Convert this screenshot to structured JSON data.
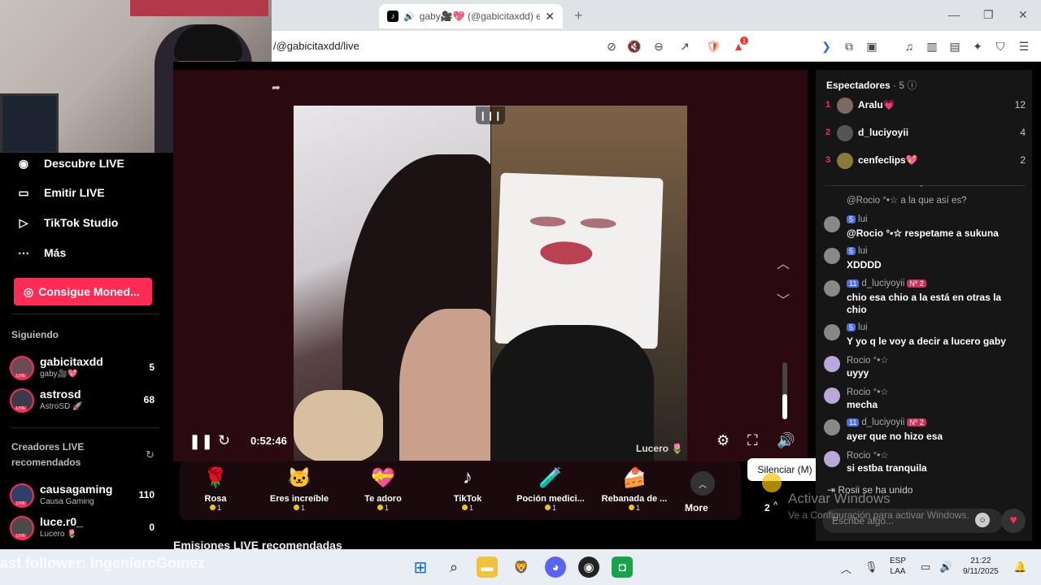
{
  "browser": {
    "tab_title": "gaby🎥💖 (@gabicitaxdd) es",
    "url": "/@gabicitaxdd/live",
    "new_tab": "+",
    "ext_badge": "1"
  },
  "sidebar": {
    "nav": [
      {
        "label": "Descubre LIVE",
        "icon": "live-discover-icon"
      },
      {
        "label": "Emitir LIVE",
        "icon": "camera-icon"
      },
      {
        "label": "TikTok Studio",
        "icon": "studio-icon"
      },
      {
        "label": "Más",
        "icon": "more-dots-icon"
      }
    ],
    "coins_button": "Consigue Moned...",
    "following_title": "Siguiendo",
    "following": [
      {
        "name": "gabicitaxdd",
        "sub": "gaby🎥💖",
        "count": "5",
        "live": "LIVE"
      },
      {
        "name": "astrosd",
        "sub": "AstroSD 🚀",
        "count": "68",
        "live": "LIVE"
      }
    ],
    "creators_title_1": "Creadores LIVE",
    "creators_title_2": "recomendados",
    "creators": [
      {
        "name": "causagaming",
        "sub": "Causa Gaming",
        "count": "110",
        "live": "LIVE"
      },
      {
        "name": "luce.r0_",
        "sub": "Lucero 🌷",
        "count": "0",
        "live": "LIVE"
      }
    ]
  },
  "player": {
    "time": "0:52:46",
    "host_label": "Lucero 🌷",
    "tooltip": "Silenciar (M)",
    "volume": 0.45,
    "side_count": "2"
  },
  "gifts": [
    {
      "name": "Rosa",
      "price": "1",
      "icon": "🌹"
    },
    {
      "name": "Eres increíble",
      "price": "1",
      "icon": "🐱"
    },
    {
      "name": "Te adoro",
      "price": "1",
      "icon": "💝"
    },
    {
      "name": "TikTok",
      "price": "1",
      "icon": "♪"
    },
    {
      "name": "Poción medici...",
      "price": "1",
      "icon": "🧪"
    },
    {
      "name": "Rebanada de ...",
      "price": "1",
      "icon": "🍰"
    }
  ],
  "more_label": "More",
  "recommended_title": "Emisiones LIVE recomendadas",
  "viewers": {
    "title": "Espectadores",
    "count": "· 5",
    "list": [
      {
        "rank": "1",
        "name": "Aralu💗",
        "score": "12"
      },
      {
        "rank": "2",
        "name": "d_luciyoyii",
        "score": "4"
      },
      {
        "rank": "3",
        "name": "cenfeclips💖",
        "score": "2"
      }
    ]
  },
  "chat": [
    {
      "user": "@Rocio °•☆ a la que así es?",
      "text": "",
      "level": "",
      "fan": ""
    },
    {
      "user": "lui",
      "text": "@Rocio °•☆ respetame a sukuna",
      "level": "5",
      "fan": ""
    },
    {
      "user": "lui",
      "text": "XDDDD",
      "level": "5",
      "fan": ""
    },
    {
      "user": "d_luciyoyii",
      "text": "chio esa chio a la está en otras la chio",
      "level": "11",
      "fan": "Nº 2"
    },
    {
      "user": "lui",
      "text": "Y yo q le voy a decir a lucero gaby",
      "level": "5",
      "fan": ""
    },
    {
      "user": "Rocio °•☆",
      "text": "uyyy",
      "level": "",
      "fan": ""
    },
    {
      "user": "Rocio °•☆",
      "text": "mecha",
      "level": "",
      "fan": ""
    },
    {
      "user": "d_luciyoyii",
      "text": "ayer que no hizo esa",
      "level": "11",
      "fan": "Nº 2"
    },
    {
      "user": "Rocio °•☆",
      "text": "si estba tranquila",
      "level": "",
      "fan": ""
    }
  ],
  "joined": "Rosii  se ha unido",
  "comment_placeholder": "Escribe algo...",
  "watermark_title": "Activar Windows",
  "watermark_sub": "Ve a Configuración para activar Windows.",
  "ticker": "ast follower: IngenieroGomez",
  "tray": {
    "lang": "ESP",
    "layout": "LAA",
    "time": "21:22",
    "date": "9/11/2025"
  },
  "colors": {
    "accent": "#fe2c55",
    "level_badge": "#4b6ee6",
    "coin": "#f5c400"
  }
}
